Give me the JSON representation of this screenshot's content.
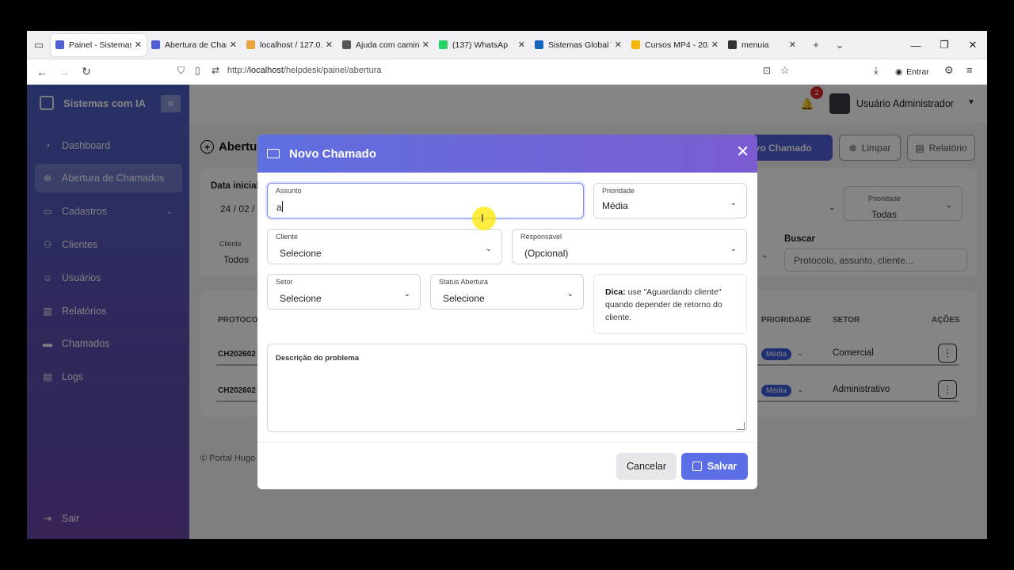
{
  "browser": {
    "tabs": [
      {
        "title": "Painel - Sistemas c",
        "color": "#4f5fd6",
        "active": true
      },
      {
        "title": "Abertura de Cham",
        "color": "#4f5fd6",
        "active": false
      },
      {
        "title": "localhost / 127.0.0",
        "color": "#e8a33d",
        "active": false
      },
      {
        "title": "Ajuda com caminh",
        "color": "#555555",
        "active": false
      },
      {
        "title": "(137) WhatsAp",
        "color": "#25d366",
        "active": false
      },
      {
        "title": "Sistemas Global Te",
        "color": "#1565c0",
        "active": false
      },
      {
        "title": "Cursos MP4 - 2026",
        "color": "#f4b400",
        "active": false
      },
      {
        "title": "menuia",
        "color": "#333333",
        "active": false
      }
    ],
    "url_prefix": "http://",
    "url_host": "localhost",
    "url_path": "/helpdesk/painel/abertura",
    "signin_label": "Entrar"
  },
  "sidebar": {
    "brand": "Sistemas com IA",
    "items": [
      {
        "label": "Dashboard",
        "icon": "dashboard-icon"
      },
      {
        "label": "Abertura de Chamados",
        "icon": "plus-circle-icon"
      },
      {
        "label": "Cadastros",
        "icon": "folder-icon"
      },
      {
        "label": "Clientes",
        "icon": "clients-icon"
      },
      {
        "label": "Usuários",
        "icon": "user-icon"
      },
      {
        "label": "Relatórios",
        "icon": "chart-icon"
      },
      {
        "label": "Chamados",
        "icon": "ticket-icon"
      },
      {
        "label": "Logs",
        "icon": "log-icon"
      }
    ],
    "logout": "Sair"
  },
  "header": {
    "notifications_count": "2",
    "user_name": "Usuário Administrador"
  },
  "page": {
    "title": "Abertu",
    "new_button": "ovo Chamado",
    "clear_button": "Limpar",
    "report_button": "Relatório"
  },
  "filters": {
    "date_label": "Data inicial",
    "date_value": "24 / 02 /",
    "client_label": "Cliente",
    "client_value": "Todos",
    "priority_label": "Prioridade",
    "priority_value": "Todas",
    "search_label": "Buscar",
    "search_placeholder": "Protocolo, assunto, cliente..."
  },
  "table": {
    "headers": {
      "protocol": "PROTOCO",
      "priority": "PRIORIDADE",
      "sector": "SETOR",
      "actions": "AÇÕES"
    },
    "rows": [
      {
        "protocol": "CH202602",
        "priority": "Média",
        "sector": "Comercial"
      },
      {
        "protocol": "CH202602",
        "priority": "Média",
        "sector": "Administrativo"
      }
    ]
  },
  "footer": "© Portal Hugo",
  "modal": {
    "title": "Novo Chamado",
    "subject_label": "Assunto",
    "subject_value": "a",
    "priority_label": "Prioridade",
    "priority_value": "Média",
    "client_label": "Cliente",
    "client_value": "Selecione",
    "responsible_label": "Responsável",
    "responsible_value": "(Opcional)",
    "sector_label": "Setor",
    "sector_value": "Selecione",
    "status_label": "Status Abertura",
    "status_value": "Selecione",
    "tip_bold": "Dica:",
    "tip_text": " use \"Aguardando cliente\" quando depender de retorno do cliente.",
    "description_label": "Descrição do problema",
    "cancel": "Cancelar",
    "save": "Salvar"
  }
}
